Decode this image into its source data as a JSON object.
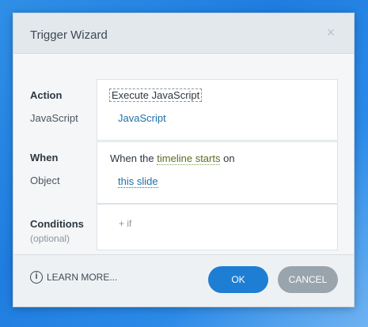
{
  "dialog": {
    "title": "Trigger Wizard",
    "close_glyph": "×"
  },
  "action": {
    "label": "Action",
    "value": "Execute JavaScript",
    "sub_label": "JavaScript",
    "sub_value": "JavaScript"
  },
  "when": {
    "label": "When",
    "prefix": "When the",
    "event": "timeline starts",
    "suffix": "on",
    "sub_label": "Object",
    "sub_value": "this slide"
  },
  "conditions": {
    "label": "Conditions",
    "optional": "(optional)",
    "add": "+ if"
  },
  "footer": {
    "learn_more": "LEARN MORE...",
    "info_glyph": "i",
    "ok": "OK",
    "cancel": "CANCEL"
  }
}
